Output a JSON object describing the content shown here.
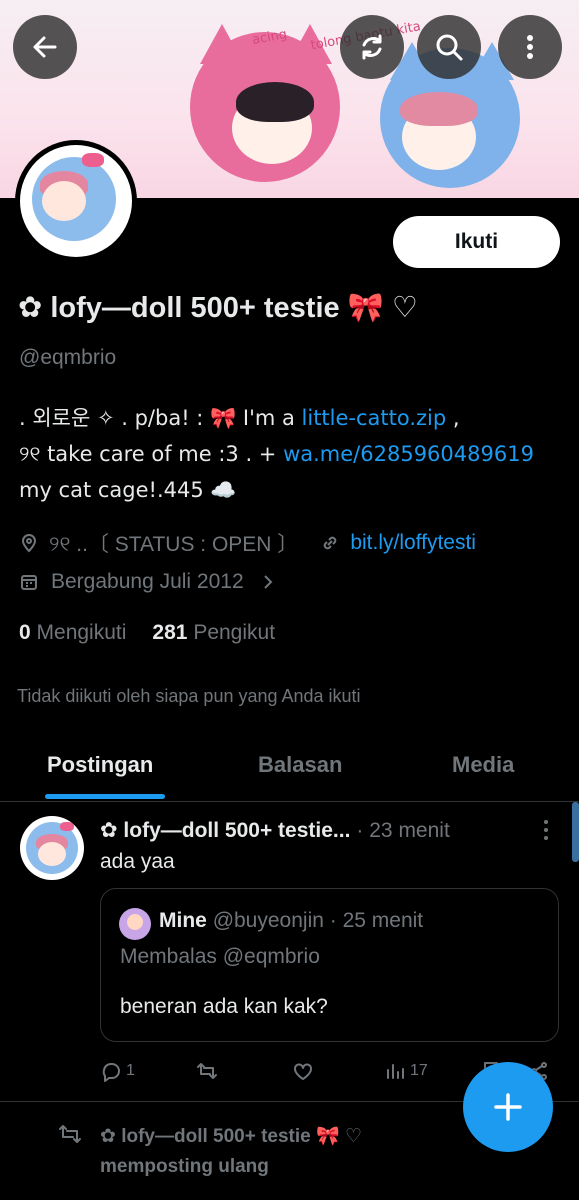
{
  "banner": {
    "doodle_text_1": "acing",
    "doodle_text_2": "tolong bantu kita"
  },
  "toolbar": {
    "back_icon": "arrow-left-icon",
    "refresh_icon": "refresh-icon",
    "search_icon": "search-icon",
    "more_icon": "more-vertical-icon"
  },
  "profile": {
    "follow_label": "Ikuti",
    "display_name": "✿ lofy—doll 500+ testie 🎀 ♡",
    "handle": "@eqmbrio",
    "bio_line1_prefix": ".   외로운   ✧     . p/ba! : 🎀 I'm a ",
    "bio_link1": "little-catto.zip",
    "bio_line1_suffix": " ,",
    "bio_line2_prefix": "୨୧ take care of me :3 . +  ",
    "bio_link2": "wa.me/6285960489619",
    "bio_line3_suffix": " my cat cage!.445 ☁️",
    "location": "୨୧ ..〔 STATUS : OPEN 〕",
    "website": "bit.ly/loffytesti",
    "joined": "Bergabung Juli 2012",
    "following_count": "0",
    "following_label": "Mengikuti",
    "followers_count": "281",
    "followers_label": "Pengikut",
    "not_followed": "Tidak diikuti oleh siapa pun yang Anda ikuti"
  },
  "tabs": [
    {
      "label": "Postingan",
      "active": true
    },
    {
      "label": "Balasan",
      "active": false
    },
    {
      "label": "Media",
      "active": false
    }
  ],
  "post": {
    "author": "✿ lofy—doll 500+ testie...",
    "time": "· 23 menit",
    "text": "ada yaa",
    "quote": {
      "author": "Mine",
      "handle": "@buyeonjin",
      "time": "· 25 menit",
      "reply_to": "Membalas @eqmbrio",
      "text": "beneran ada kan kak?"
    },
    "actions": {
      "replies": "1",
      "views": "17"
    }
  },
  "retweet_notice": {
    "text": "✿ lofy—doll 500+ testie 🎀 ♡ memposting ulang"
  },
  "colors": {
    "accent": "#1d9bf0",
    "muted": "#71767b",
    "text": "#e7e9ea",
    "background": "#000000"
  }
}
